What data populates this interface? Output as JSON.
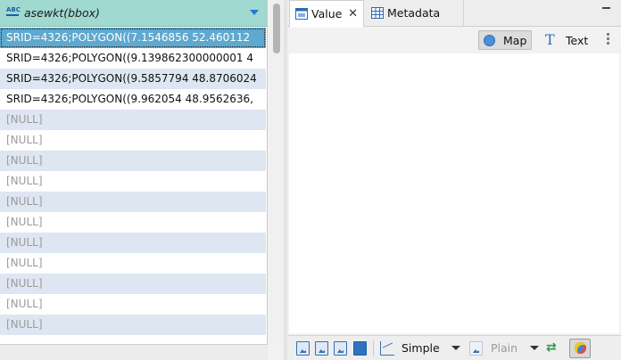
{
  "grid": {
    "column_header": "asewkt(bbox)",
    "column_type_badge": "ABC",
    "sort_icon": "chevron-down-icon",
    "rows": [
      "SRID=4326;POLYGON((7.1546856 52.460112",
      "SRID=4326;POLYGON((9.139862300000001 4",
      "SRID=4326;POLYGON((9.5857794 48.8706024",
      "SRID=4326;POLYGON((9.962054 48.9562636,",
      "[NULL]",
      "[NULL]",
      "[NULL]",
      "[NULL]",
      "[NULL]",
      "[NULL]",
      "[NULL]",
      "[NULL]",
      "[NULL]",
      "[NULL]",
      "[NULL]"
    ],
    "selected_row": 0
  },
  "value_panel": {
    "tabs": [
      {
        "label": "Value",
        "icon": "value-panel-icon",
        "active": true
      },
      {
        "label": "Metadata",
        "icon": "grid-icon",
        "active": false
      }
    ],
    "tab_close_glyph": "✕",
    "viewer_buttons": {
      "map_label": "Map",
      "text_label": "Text",
      "text_glyph": "T"
    }
  },
  "bottom_bar": {
    "simple_label": "Simple",
    "plain_label": "Plain",
    "swap_glyph": "⇄"
  },
  "colors": {
    "header_bg": "#9fd9cf",
    "selected_row_bg": "#5fa9cf",
    "alt_row_bg": "#dde6f1",
    "accent_blue": "#1e7ad6"
  }
}
